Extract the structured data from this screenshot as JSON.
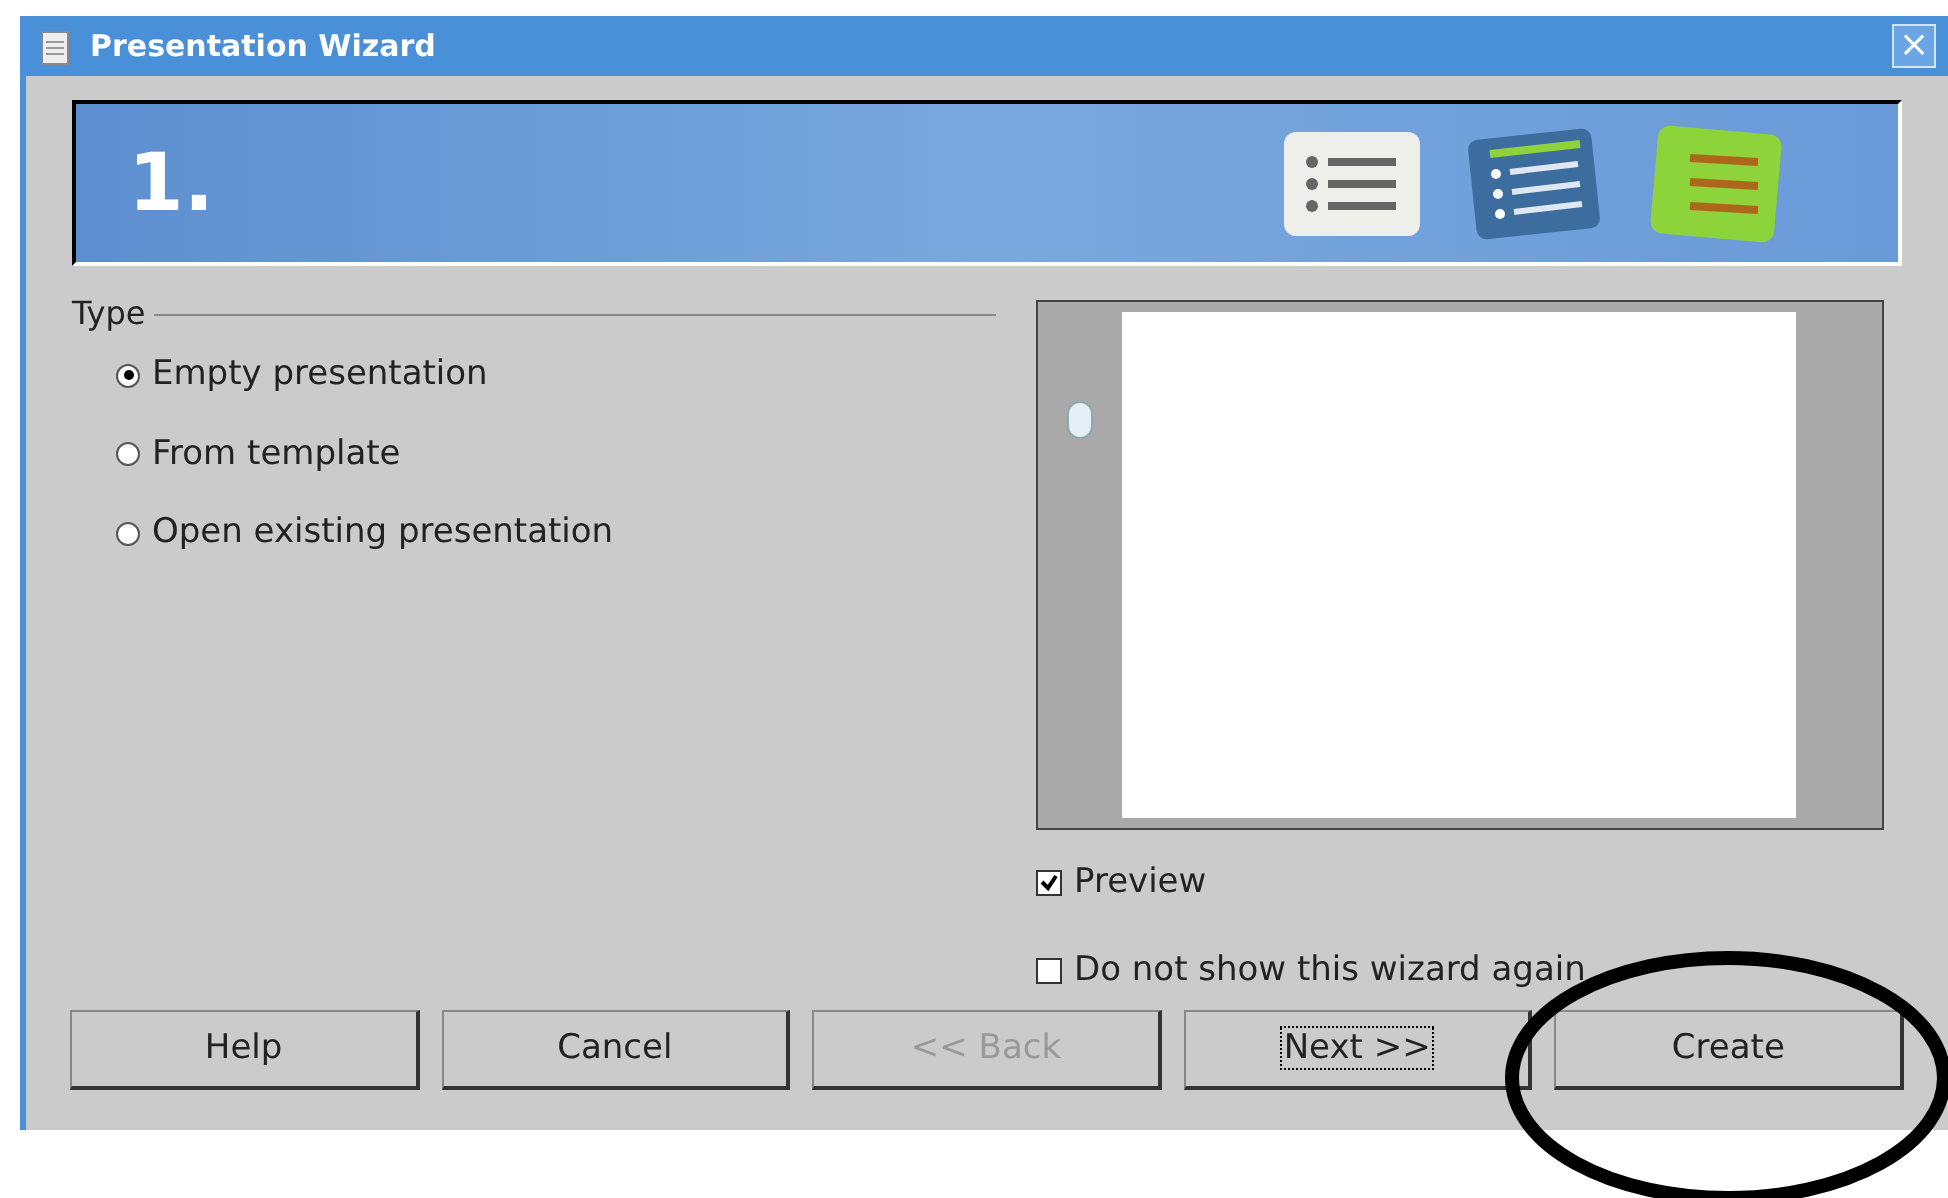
{
  "window": {
    "title": "Presentation Wizard",
    "close": "×"
  },
  "banner": {
    "step": "1."
  },
  "type_group": {
    "label": "Type",
    "options": [
      {
        "label": "Empty presentation",
        "selected": true
      },
      {
        "label": "From template",
        "selected": false
      },
      {
        "label": "Open existing presentation",
        "selected": false
      }
    ]
  },
  "checkboxes": [
    {
      "label": "Preview",
      "checked": true
    },
    {
      "label": "Do not show this wizard again",
      "checked": false
    }
  ],
  "buttons": [
    {
      "label": "Help",
      "disabled": false,
      "focused": false
    },
    {
      "label": "Cancel",
      "disabled": false,
      "focused": false
    },
    {
      "label": "<< Back",
      "disabled": true,
      "focused": false
    },
    {
      "label": "Next >>",
      "disabled": false,
      "focused": true
    },
    {
      "label": "Create",
      "disabled": false,
      "focused": false
    }
  ]
}
